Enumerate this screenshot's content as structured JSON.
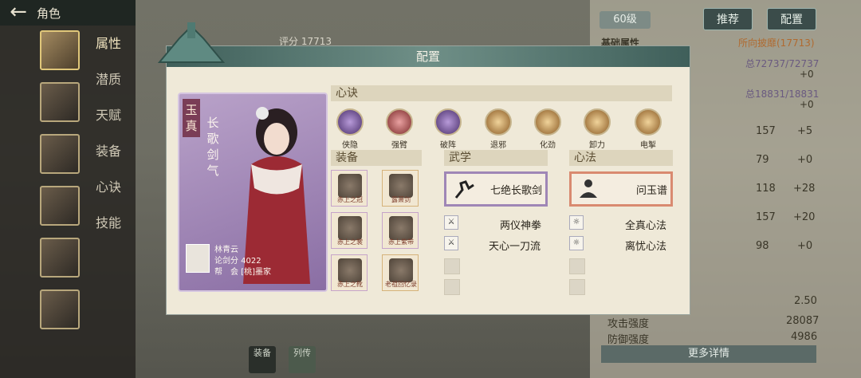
{
  "topbar": {
    "title": "角色"
  },
  "sidebar_menu": [
    "属性",
    "潜质",
    "天赋",
    "装备",
    "心诀",
    "技能"
  ],
  "right_panel": {
    "level": "60级",
    "btn_recommend": "推荐",
    "btn_config": "配置",
    "score": "评分 17713",
    "base_attr": "基础属性",
    "all_equip": "所向披靡(17713)",
    "hp": "总72737/72737",
    "plus0a": "+0",
    "mp": "总18831/18831",
    "plus0b": "+0",
    "rows": [
      {
        "value": "157",
        "delta": "+5"
      },
      {
        "value": "79",
        "delta": "+0"
      },
      {
        "value": "118",
        "delta": "+28"
      },
      {
        "value": "157",
        "delta": "+20"
      },
      {
        "value": "98",
        "delta": "+0"
      }
    ],
    "stat1": "2.50",
    "attack_label": "攻击强度",
    "attack_val": "28087",
    "defense_label": "防御强度",
    "defense_val": "4986",
    "more": "更多详情"
  },
  "dialog": {
    "title": "配置",
    "card": {
      "tag": "玉真",
      "vertical_title": "长歌剑气",
      "name": "林青云",
      "score": "论剑分 4022",
      "guild": "帮　会 [桃]墨家"
    },
    "xinjue_title": "心诀",
    "skills": [
      "侠隐",
      "强臂",
      "破阵",
      "退邪",
      "化劲",
      "卸力",
      "电掣"
    ],
    "equip_title": "装备",
    "equips": [
      "赤上之冠",
      "露萧剑",
      "赤上之裳",
      "赤上紫带",
      "赤上之靴",
      "老祖回忆录"
    ],
    "wuxue_title": "武学",
    "wuxue_main": "七绝长歌剑",
    "wuxue_list": [
      "两仪神拳",
      "天心一刀流"
    ],
    "xinfa_title": "心法",
    "xinfa_main": "问玉谱",
    "xinfa_list": [
      "全真心法",
      "离忧心法"
    ]
  },
  "bottom": {
    "btn_a": "装备",
    "btn_b": "列传"
  },
  "colors": {
    "accent": "#3f5f5a",
    "purple_frame": "#9f86b6",
    "red_frame": "#d98a70"
  }
}
